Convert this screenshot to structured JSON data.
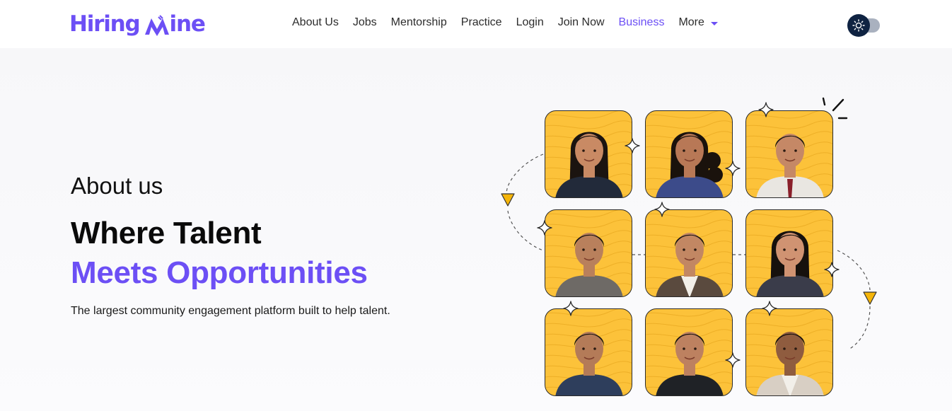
{
  "brand": {
    "name_part1": "Hiring",
    "name_part2": "ine",
    "color": "#6c4ff5"
  },
  "nav": {
    "items": [
      {
        "label": "About Us",
        "active": false
      },
      {
        "label": "Jobs",
        "active": false
      },
      {
        "label": "Mentorship",
        "active": false
      },
      {
        "label": "Practice",
        "active": false
      },
      {
        "label": "Login",
        "active": false
      },
      {
        "label": "Join Now",
        "active": false
      },
      {
        "label": "Business",
        "active": true
      }
    ],
    "more_label": "More",
    "more_icon": "chevron-down-icon",
    "theme_toggle_icon": "sun-icon"
  },
  "hero": {
    "section_label": "About us",
    "headline_line1": "Where Talent",
    "headline_line2": "Meets Opportunities",
    "tagline": "The largest community engagement platform built to help talent."
  },
  "people_grid": {
    "card_count": 9,
    "background_color": "#fcc23a",
    "accent_marker_color": "#f5b50a"
  },
  "colors": {
    "accent": "#6c4ff5",
    "text": "#0a0a0a",
    "toggle_knob": "#0f2342",
    "toggle_track": "#a9b1bf"
  }
}
